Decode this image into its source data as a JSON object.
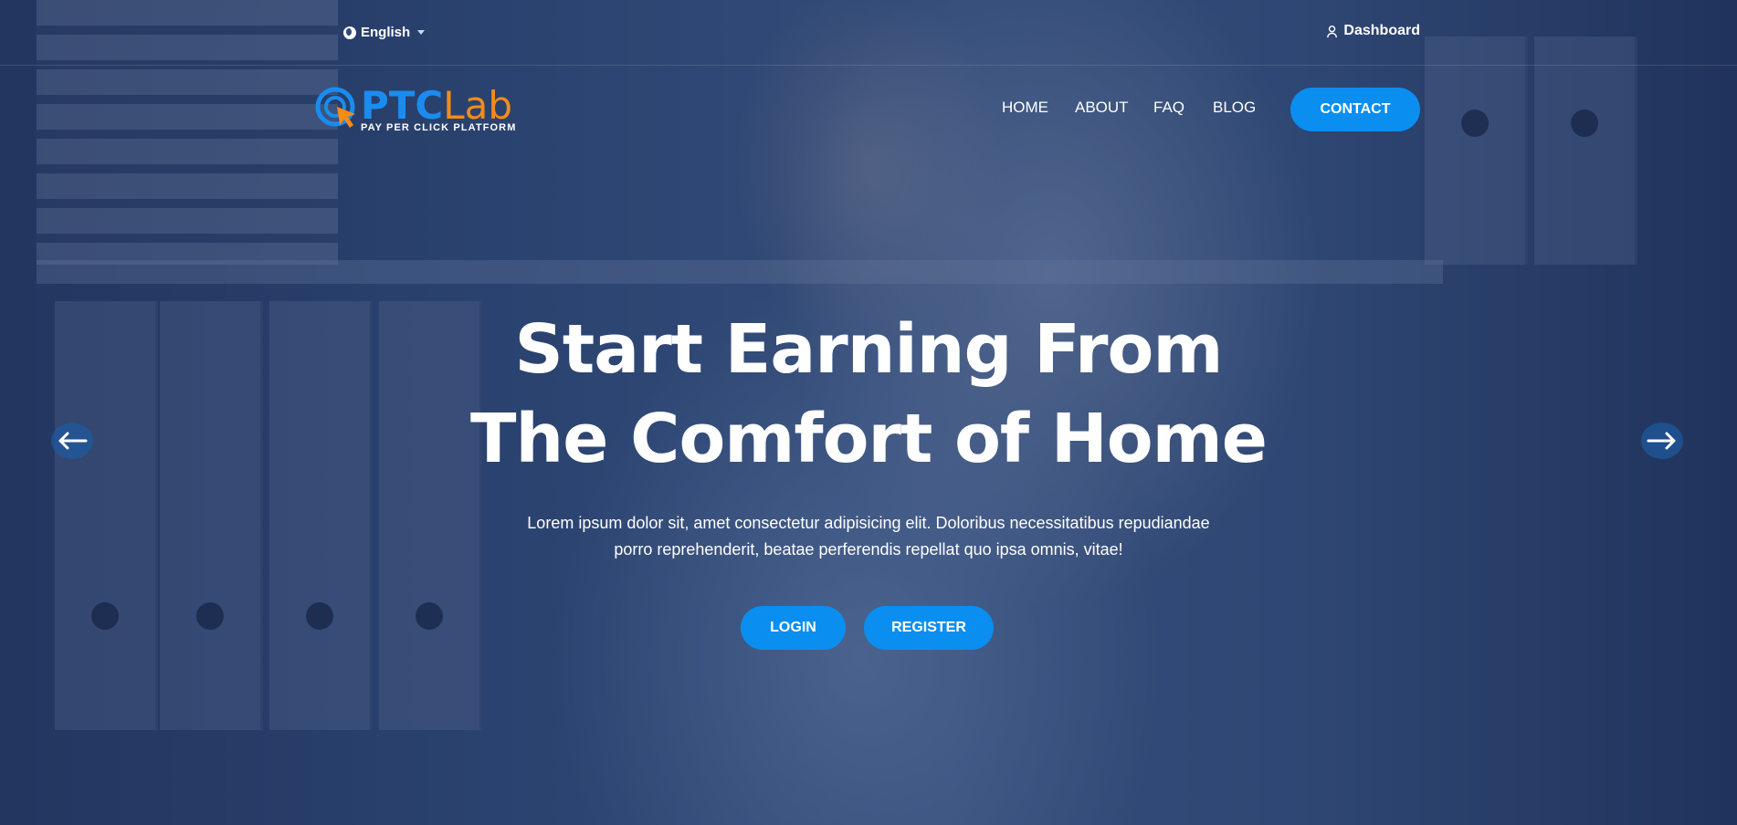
{
  "topbar": {
    "language": "English",
    "dashboard_label": "Dashboard"
  },
  "brand": {
    "name_part1": "PTC",
    "name_part2": "Lab",
    "tagline": "PAY PER CLICK PLATFORM"
  },
  "nav": {
    "items": [
      {
        "label": "HOME"
      },
      {
        "label": "ABOUT"
      },
      {
        "label": "FAQ"
      },
      {
        "label": "BLOG"
      }
    ],
    "contact_label": "CONTACT"
  },
  "hero": {
    "headline_line1": "Start Earning From",
    "headline_line2": "The Comfort of Home",
    "subtitle_line1": "Lorem ipsum dolor sit, amet consectetur adipisicing elit. Doloribus necessitatibus repudiandae",
    "subtitle_line2": "porro reprehenderit, beatae perferendis repellat quo ipsa omnis, vitae!",
    "login_label": "LOGIN",
    "register_label": "REGISTER"
  },
  "colors": {
    "accent": "#0a8ff0",
    "logo_blue": "#1a8cf0",
    "logo_orange": "#f28c1a"
  },
  "icons": {
    "language": "globe-icon",
    "dashboard": "user-icon",
    "prev": "arrow-left-icon",
    "next": "arrow-right-icon"
  }
}
